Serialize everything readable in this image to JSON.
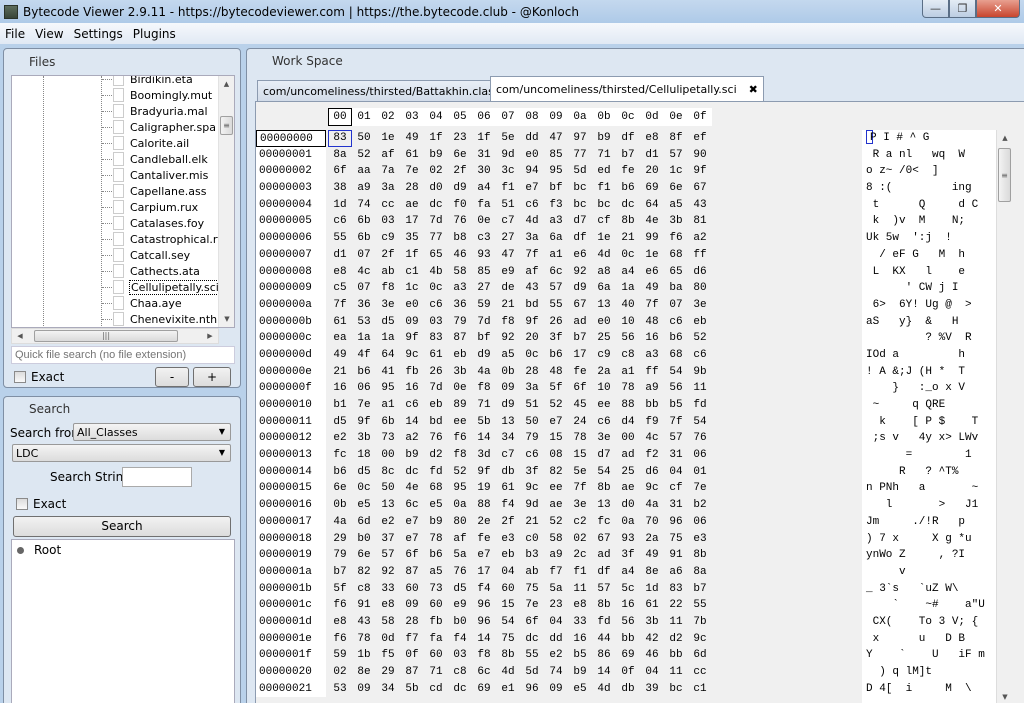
{
  "window": {
    "title": "Bytecode Viewer 2.9.11 - https://bytecodeviewer.com | https://the.bytecode.club - @Konloch",
    "minimize_glyph": "—",
    "restore_glyph": "❐",
    "close_glyph": "✕"
  },
  "menu": [
    "File",
    "View",
    "Settings",
    "Plugins"
  ],
  "files_panel": {
    "title": "Files",
    "files": [
      "Birdikin.eta",
      "Boomingly.mut",
      "Bradyuria.mal",
      "Caligrapher.spa",
      "Calorite.ail",
      "Candleball.elk",
      "Cantaliver.mis",
      "Capellane.ass",
      "Carpium.rux",
      "Catalases.foy",
      "Catastrophical.rte",
      "Catcall.sey",
      "Cathects.ata",
      "Cellulipetally.sci",
      "Chaa.aye",
      "Chenevixite.nth"
    ],
    "selected_file": "Cellulipetally.sci",
    "quick_search_placeholder": "Quick file search (no file extension)",
    "exact_label": "Exact",
    "exact_checked": false,
    "minus_label": "-",
    "plus_label": "+"
  },
  "search_panel": {
    "title": "Search",
    "search_from_label": "Search from",
    "search_from_value": "All_Classes",
    "search_type_value": "LDC",
    "search_string_label": "Search String:",
    "search_string_value": "",
    "exact_label": "Exact",
    "exact_checked": false,
    "search_button": "Search",
    "results_root": "Root"
  },
  "workspace": {
    "title": "Work Space",
    "tabs": [
      {
        "label": "com/uncomeliness/thirsted/Battakhin.class",
        "active": false
      },
      {
        "label": "com/uncomeliness/thirsted/Cellulipetally.sci",
        "active": true
      }
    ],
    "tab_close_glyph": "✖",
    "hex": {
      "columns": [
        "00",
        "01",
        "02",
        "03",
        "04",
        "05",
        "06",
        "07",
        "08",
        "09",
        "0a",
        "0b",
        "0c",
        "0d",
        "0e",
        "0f"
      ],
      "rows": [
        {
          "offset": "00000000",
          "bytes": [
            "83",
            "50",
            "1e",
            "49",
            "1f",
            "23",
            "1f",
            "5e",
            "dd",
            "47",
            "97",
            "b9",
            "df",
            "e8",
            "8f",
            "ef"
          ],
          "ascii": "P I # ^ G"
        },
        {
          "offset": "00000001",
          "bytes": [
            "8a",
            "52",
            "af",
            "61",
            "b9",
            "6e",
            "31",
            "9d",
            "e0",
            "85",
            "77",
            "71",
            "b7",
            "d1",
            "57",
            "90"
          ],
          "ascii": " R a nl   wq  W"
        },
        {
          "offset": "00000002",
          "bytes": [
            "6f",
            "aa",
            "7a",
            "7e",
            "02",
            "2f",
            "30",
            "3c",
            "94",
            "95",
            "5d",
            "ed",
            "fe",
            "20",
            "1c",
            "9f"
          ],
          "ascii": "o z~ /0<  ]"
        },
        {
          "offset": "00000003",
          "bytes": [
            "38",
            "a9",
            "3a",
            "28",
            "d0",
            "d9",
            "a4",
            "f1",
            "e7",
            "bf",
            "bc",
            "f1",
            "b6",
            "69",
            "6e",
            "67"
          ],
          "ascii": "8 :(         ing"
        },
        {
          "offset": "00000004",
          "bytes": [
            "1d",
            "74",
            "cc",
            "ae",
            "dc",
            "f0",
            "fa",
            "51",
            "c6",
            "f3",
            "bc",
            "bc",
            "dc",
            "64",
            "a5",
            "43"
          ],
          "ascii": " t      Q     d C"
        },
        {
          "offset": "00000005",
          "bytes": [
            "c6",
            "6b",
            "03",
            "17",
            "7d",
            "76",
            "0e",
            "c7",
            "4d",
            "a3",
            "d7",
            "cf",
            "8b",
            "4e",
            "3b",
            "81"
          ],
          "ascii": " k  )v  M    N;"
        },
        {
          "offset": "00000006",
          "bytes": [
            "55",
            "6b",
            "c9",
            "35",
            "77",
            "b8",
            "c3",
            "27",
            "3a",
            "6a",
            "df",
            "1e",
            "21",
            "99",
            "f6",
            "a2"
          ],
          "ascii": "Uk 5w  ':j  !"
        },
        {
          "offset": "00000007",
          "bytes": [
            "d1",
            "07",
            "2f",
            "1f",
            "65",
            "46",
            "93",
            "47",
            "7f",
            "a1",
            "e6",
            "4d",
            "0c",
            "1e",
            "68",
            "ff"
          ],
          "ascii": "  / eF G   M  h"
        },
        {
          "offset": "00000008",
          "bytes": [
            "e8",
            "4c",
            "ab",
            "c1",
            "4b",
            "58",
            "85",
            "e9",
            "af",
            "6c",
            "92",
            "a8",
            "a4",
            "e6",
            "65",
            "d6"
          ],
          "ascii": " L  KX   l    e"
        },
        {
          "offset": "00000009",
          "bytes": [
            "c5",
            "07",
            "f8",
            "1c",
            "0c",
            "a3",
            "27",
            "de",
            "43",
            "57",
            "d9",
            "6a",
            "1a",
            "49",
            "ba",
            "80"
          ],
          "ascii": "      ' CW j I"
        },
        {
          "offset": "0000000a",
          "bytes": [
            "7f",
            "36",
            "3e",
            "e0",
            "c6",
            "36",
            "59",
            "21",
            "bd",
            "55",
            "67",
            "13",
            "40",
            "7f",
            "07",
            "3e"
          ],
          "ascii": " 6>  6Y! Ug @  >"
        },
        {
          "offset": "0000000b",
          "bytes": [
            "61",
            "53",
            "d5",
            "09",
            "03",
            "79",
            "7d",
            "f8",
            "9f",
            "26",
            "ad",
            "e0",
            "10",
            "48",
            "c6",
            "eb"
          ],
          "ascii": "aS   y}  &   H"
        },
        {
          "offset": "0000000c",
          "bytes": [
            "ea",
            "1a",
            "1a",
            "9f",
            "83",
            "87",
            "bf",
            "92",
            "20",
            "3f",
            "b7",
            "25",
            "56",
            "16",
            "b6",
            "52"
          ],
          "ascii": "         ? %V  R"
        },
        {
          "offset": "0000000d",
          "bytes": [
            "49",
            "4f",
            "64",
            "9c",
            "61",
            "eb",
            "d9",
            "a5",
            "0c",
            "b6",
            "17",
            "c9",
            "c8",
            "a3",
            "68",
            "c6"
          ],
          "ascii": "IOd a         h"
        },
        {
          "offset": "0000000e",
          "bytes": [
            "21",
            "b6",
            "41",
            "fb",
            "26",
            "3b",
            "4a",
            "0b",
            "28",
            "48",
            "fe",
            "2a",
            "a1",
            "ff",
            "54",
            "9b"
          ],
          "ascii": "! A &;J (H *  T"
        },
        {
          "offset": "0000000f",
          "bytes": [
            "16",
            "06",
            "95",
            "16",
            "7d",
            "0e",
            "f8",
            "09",
            "3a",
            "5f",
            "6f",
            "10",
            "78",
            "a9",
            "56",
            "11"
          ],
          "ascii": "    }   :_o x V"
        },
        {
          "offset": "00000010",
          "bytes": [
            "b1",
            "7e",
            "a1",
            "c6",
            "eb",
            "89",
            "71",
            "d9",
            "51",
            "52",
            "45",
            "ee",
            "88",
            "bb",
            "b5",
            "fd"
          ],
          "ascii": " ~     q QRE"
        },
        {
          "offset": "00000011",
          "bytes": [
            "d5",
            "9f",
            "6b",
            "14",
            "bd",
            "ee",
            "5b",
            "13",
            "50",
            "e7",
            "24",
            "c6",
            "d4",
            "f9",
            "7f",
            "54"
          ],
          "ascii": "  k    [ P $    T"
        },
        {
          "offset": "00000012",
          "bytes": [
            "e2",
            "3b",
            "73",
            "a2",
            "76",
            "f6",
            "14",
            "34",
            "79",
            "15",
            "78",
            "3e",
            "00",
            "4c",
            "57",
            "76"
          ],
          "ascii": " ;s v   4y x> LWv"
        },
        {
          "offset": "00000013",
          "bytes": [
            "fc",
            "18",
            "00",
            "b9",
            "d2",
            "f8",
            "3d",
            "c7",
            "c6",
            "08",
            "15",
            "d7",
            "ad",
            "f2",
            "31",
            "06"
          ],
          "ascii": "      =        1"
        },
        {
          "offset": "00000014",
          "bytes": [
            "b6",
            "d5",
            "8c",
            "dc",
            "fd",
            "52",
            "9f",
            "db",
            "3f",
            "82",
            "5e",
            "54",
            "25",
            "d6",
            "04",
            "01"
          ],
          "ascii": "     R   ? ^T%"
        },
        {
          "offset": "00000015",
          "bytes": [
            "6e",
            "0c",
            "50",
            "4e",
            "68",
            "95",
            "19",
            "61",
            "9c",
            "ee",
            "7f",
            "8b",
            "ae",
            "9c",
            "cf",
            "7e"
          ],
          "ascii": "n PNh   a       ~"
        },
        {
          "offset": "00000016",
          "bytes": [
            "0b",
            "e5",
            "13",
            "6c",
            "e5",
            "0a",
            "88",
            "f4",
            "9d",
            "ae",
            "3e",
            "13",
            "d0",
            "4a",
            "31",
            "b2"
          ],
          "ascii": "   l       >   J1"
        },
        {
          "offset": "00000017",
          "bytes": [
            "4a",
            "6d",
            "e2",
            "e7",
            "b9",
            "80",
            "2e",
            "2f",
            "21",
            "52",
            "c2",
            "fc",
            "0a",
            "70",
            "96",
            "06"
          ],
          "ascii": "Jm     ./!R   p"
        },
        {
          "offset": "00000018",
          "bytes": [
            "29",
            "b0",
            "37",
            "e7",
            "78",
            "af",
            "fe",
            "e3",
            "c0",
            "58",
            "02",
            "67",
            "93",
            "2a",
            "75",
            "e3"
          ],
          "ascii": ") 7 x     X g *u"
        },
        {
          "offset": "00000019",
          "bytes": [
            "79",
            "6e",
            "57",
            "6f",
            "b6",
            "5a",
            "e7",
            "eb",
            "b3",
            "a9",
            "2c",
            "ad",
            "3f",
            "49",
            "91",
            "8b"
          ],
          "ascii": "ynWo Z     , ?I"
        },
        {
          "offset": "0000001a",
          "bytes": [
            "b7",
            "82",
            "92",
            "87",
            "a5",
            "76",
            "17",
            "04",
            "ab",
            "f7",
            "f1",
            "df",
            "a4",
            "8e",
            "a6",
            "8a"
          ],
          "ascii": "     v"
        },
        {
          "offset": "0000001b",
          "bytes": [
            "5f",
            "c8",
            "33",
            "60",
            "73",
            "d5",
            "f4",
            "60",
            "75",
            "5a",
            "11",
            "57",
            "5c",
            "1d",
            "83",
            "b7"
          ],
          "ascii": "_ 3`s   `uZ W\\"
        },
        {
          "offset": "0000001c",
          "bytes": [
            "f6",
            "91",
            "e8",
            "09",
            "60",
            "e9",
            "96",
            "15",
            "7e",
            "23",
            "e8",
            "8b",
            "16",
            "61",
            "22",
            "55"
          ],
          "ascii": "    `    ~#    a\"U"
        },
        {
          "offset": "0000001d",
          "bytes": [
            "e8",
            "43",
            "58",
            "28",
            "fb",
            "b0",
            "96",
            "54",
            "6f",
            "04",
            "33",
            "fd",
            "56",
            "3b",
            "11",
            "7b"
          ],
          "ascii": " CX(    To 3 V; {"
        },
        {
          "offset": "0000001e",
          "bytes": [
            "f6",
            "78",
            "0d",
            "f7",
            "fa",
            "f4",
            "14",
            "75",
            "dc",
            "dd",
            "16",
            "44",
            "bb",
            "42",
            "d2",
            "9c"
          ],
          "ascii": " x      u   D B"
        },
        {
          "offset": "0000001f",
          "bytes": [
            "59",
            "1b",
            "f5",
            "0f",
            "60",
            "03",
            "f8",
            "8b",
            "55",
            "e2",
            "b5",
            "86",
            "69",
            "46",
            "bb",
            "6d"
          ],
          "ascii": "Y    `    U   iF m"
        },
        {
          "offset": "00000020",
          "bytes": [
            "02",
            "8e",
            "29",
            "87",
            "71",
            "c8",
            "6c",
            "4d",
            "5d",
            "74",
            "b9",
            "14",
            "0f",
            "04",
            "11",
            "cc"
          ],
          "ascii": "  ) q lM]t"
        },
        {
          "offset": "00000021",
          "bytes": [
            "53",
            "09",
            "34",
            "5b",
            "cd",
            "dc",
            "69",
            "e1",
            "96",
            "09",
            "e5",
            "4d",
            "db",
            "39",
            "bc",
            "c1"
          ],
          "ascii": "D 4[  i     M  \\"
        }
      ]
    }
  }
}
